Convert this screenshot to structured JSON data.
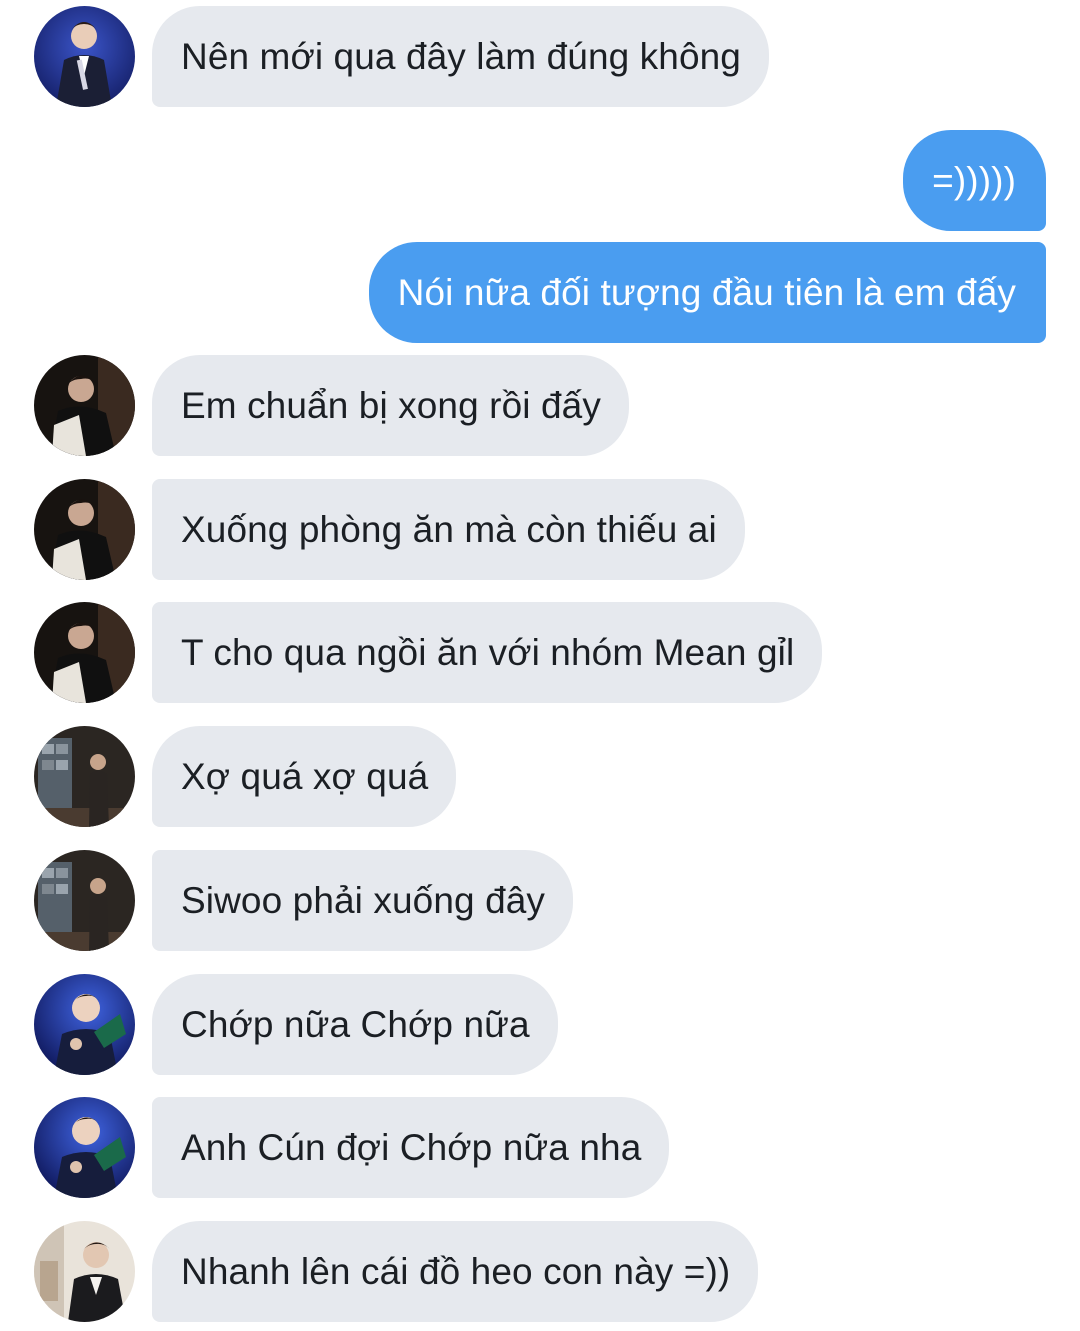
{
  "messages": [
    {
      "text": "Nên mới qua đây làm đúng không",
      "side": "in",
      "avatar": "avatar-blue-stage-icon"
    },
    {
      "text": "=)))))",
      "side": "out"
    },
    {
      "text": "Nói nữa đối tượng đầu tiên là em đấy",
      "side": "out"
    },
    {
      "text": "Em chuẩn bị xong rồi đấy",
      "side": "in",
      "avatar": "avatar-dark-portrait-icon"
    },
    {
      "text": "Xuống phòng ăn mà còn thiếu ai",
      "side": "in",
      "avatar": "avatar-dark-portrait-icon"
    },
    {
      "text": "T cho qua ngồi ăn với nhóm Mean gỉl",
      "side": "in",
      "avatar": "avatar-dark-portrait-icon"
    },
    {
      "text": "Xợ quá xợ quá",
      "side": "in",
      "avatar": "avatar-room-figure-icon"
    },
    {
      "text": "Siwoo phải xuống đây",
      "side": "in",
      "avatar": "avatar-room-figure-icon"
    },
    {
      "text": "Chớp nữa Chớp nữa",
      "side": "in",
      "avatar": "avatar-blue-stage-icon"
    },
    {
      "text": "Anh Cún đợi Chớp nữa nha",
      "side": "in",
      "avatar": "avatar-blue-stage-icon"
    },
    {
      "text": "Nhanh lên cái đồ heo con này =))",
      "side": "in",
      "avatar": "avatar-light-portrait-icon"
    }
  ],
  "colors": {
    "incoming_bubble": "#e6e9ee",
    "outgoing_bubble": "#4a9df0",
    "incoming_text": "#1b1f24",
    "outgoing_text": "#ffffff"
  }
}
